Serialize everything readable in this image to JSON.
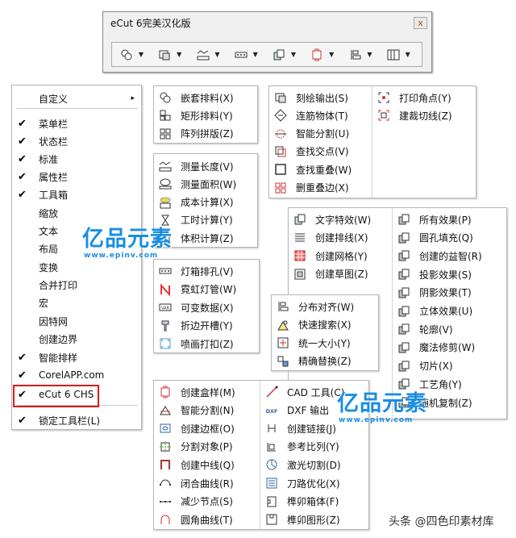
{
  "toolbar_window": {
    "title": "eCut 6完美汉化版",
    "close_label": "x",
    "groups": [
      {
        "icon": "nesting-icon"
      },
      {
        "icon": "output-icon"
      },
      {
        "icon": "measure-icon"
      },
      {
        "icon": "led-hole-icon"
      },
      {
        "icon": "effects-icon"
      },
      {
        "icon": "box-template-icon"
      },
      {
        "icon": "distribute-icon"
      },
      {
        "icon": "window-icon"
      }
    ]
  },
  "left_menu": {
    "items": [
      {
        "label": "自定义",
        "checked": false,
        "submenu": true
      },
      {
        "label": "菜单栏",
        "checked": true
      },
      {
        "label": "状态栏",
        "checked": true
      },
      {
        "label": "标准",
        "checked": true
      },
      {
        "label": "属性栏",
        "checked": true
      },
      {
        "label": "工具箱",
        "checked": true
      },
      {
        "label": "缩放",
        "checked": false
      },
      {
        "label": "文本",
        "checked": false
      },
      {
        "label": "布局",
        "checked": false
      },
      {
        "label": "变换",
        "checked": false
      },
      {
        "label": "合并打印",
        "checked": false
      },
      {
        "label": "宏",
        "checked": false
      },
      {
        "label": "因特网",
        "checked": false
      },
      {
        "label": "创建边界",
        "checked": false
      },
      {
        "label": "智能排样",
        "checked": true
      },
      {
        "label": "CorelAPP.com",
        "checked": true
      },
      {
        "label": "eCut 6 CHS",
        "checked": true
      },
      {
        "label": "锁定工具栏(L)",
        "checked": true
      }
    ],
    "check_mark": "✔",
    "submenu_arrow": "▸"
  },
  "panel_nesting": {
    "items": [
      {
        "label": "嵌套排料(X)",
        "icon": "nest-icon"
      },
      {
        "label": "矩形排料(Y)",
        "icon": "rect-nest-icon"
      },
      {
        "label": "阵列拼版(Z)",
        "icon": "array-icon"
      }
    ]
  },
  "panel_output": {
    "items": [
      {
        "label": "刻绘输出(S)",
        "icon": "cut-output-icon"
      },
      {
        "label": "连筋物体(T)",
        "icon": "bridge-icon"
      },
      {
        "label": "智能分割(U)",
        "icon": "smart-split-icon"
      },
      {
        "label": "查找交点(V)",
        "icon": "find-intersect-icon"
      },
      {
        "label": "查找重叠(W)",
        "icon": "find-overlap-icon"
      },
      {
        "label": "删重叠边(X)",
        "icon": "delete-overlap-icon"
      }
    ],
    "items_right": [
      {
        "label": "打印角点(Y)",
        "icon": "print-corner-icon"
      },
      {
        "label": "建裁切线(Z)",
        "icon": "crop-line-icon"
      }
    ]
  },
  "panel_measure": {
    "items": [
      {
        "label": "测量长度(V)",
        "icon": "measure-length-icon"
      },
      {
        "label": "测量面积(W)",
        "icon": "measure-area-icon"
      },
      {
        "label": "成本计算(X)",
        "icon": "cost-icon"
      },
      {
        "label": "工时计算(Y)",
        "icon": "hourglass-icon"
      },
      {
        "label": "体积计算(Z)",
        "icon": "volume-icon"
      }
    ]
  },
  "panel_effects": {
    "items": [
      {
        "label": "文字特效(W)",
        "icon": "text-effect-icon"
      },
      {
        "label": "创建排线(X)",
        "icon": "lines-icon"
      },
      {
        "label": "创建网格(Y)",
        "icon": "grid-icon"
      },
      {
        "label": "创建草图(Z)",
        "icon": "sketch-icon"
      }
    ],
    "items_right": [
      {
        "label": "所有效果(P)",
        "icon": "all-effects-icon"
      },
      {
        "label": "圆孔填充(Q)",
        "icon": "hole-fill-icon"
      },
      {
        "label": "创建的益智(R)",
        "icon": "puzzle-icon"
      },
      {
        "label": "投影效果(S)",
        "icon": "shadow-icon"
      },
      {
        "label": "阴影效果(T)",
        "icon": "shade-icon"
      },
      {
        "label": "立体效果(U)",
        "icon": "3d-icon"
      },
      {
        "label": "轮廓(V)",
        "icon": "contour-icon"
      },
      {
        "label": "魔法修剪(W)",
        "icon": "magic-trim-icon"
      },
      {
        "label": "切片(X)",
        "icon": "slice-icon"
      },
      {
        "label": "工艺角(Y)",
        "icon": "craft-corner-icon"
      },
      {
        "label": "随机复制(Z)",
        "icon": "random-copy-icon"
      }
    ]
  },
  "panel_led": {
    "items": [
      {
        "label": "灯箱排孔(V)",
        "icon": "led-hole-icon"
      },
      {
        "label": "霓虹灯管(W)",
        "icon": "neon-icon"
      },
      {
        "label": "可变数据(X)",
        "icon": "variable-data-icon"
      },
      {
        "label": "折边开槽(Y)",
        "icon": "fold-slot-icon"
      },
      {
        "label": "喷画打扣(Z)",
        "icon": "grommet-icon"
      }
    ]
  },
  "panel_distribute": {
    "items": [
      {
        "label": "分布对齐(W)",
        "icon": "distribute-icon"
      },
      {
        "label": "快速搜索(X)",
        "icon": "quick-search-icon"
      },
      {
        "label": "统一大小(Y)",
        "icon": "uniform-size-icon"
      },
      {
        "label": "精确替换(Z)",
        "icon": "replace-icon"
      }
    ]
  },
  "panel_box": {
    "items": [
      {
        "label": "创建盒样(M)",
        "icon": "box-icon"
      },
      {
        "label": "智能分割(N)",
        "icon": "smart-split-2-icon"
      },
      {
        "label": "创建边框(O)",
        "icon": "frame-icon"
      },
      {
        "label": "分割对象(P)",
        "icon": "split-object-icon"
      },
      {
        "label": "创建中线(Q)",
        "icon": "centerline-icon"
      },
      {
        "label": "闭合曲线(R)",
        "icon": "close-curve-icon"
      },
      {
        "label": "减少节点(S)",
        "icon": "reduce-nodes-icon"
      },
      {
        "label": "圆角曲线(T)",
        "icon": "round-curve-icon"
      }
    ],
    "items_right": [
      {
        "label": "CAD 工具(C)",
        "icon": "cad-icon"
      },
      {
        "label": "DXF 输出",
        "icon": "dxf-icon",
        "icon_text": "DXF"
      },
      {
        "label": "创建链接(J)",
        "icon": "link-icon"
      },
      {
        "label": "参考比列(Y)",
        "icon": "scale-ref-icon"
      },
      {
        "label": "激光切割(D)",
        "icon": "laser-icon"
      },
      {
        "label": "刀路优化(X)",
        "icon": "toolpath-icon"
      },
      {
        "label": "榫卯箱体(F)",
        "icon": "tenon-box-icon"
      },
      {
        "label": "榫卯图形(Z)",
        "icon": "tenon-shape-icon"
      }
    ]
  },
  "watermark": {
    "name": "亿品元素",
    "url": "www.epinv.com"
  },
  "footer": "头条 @四色印素材库"
}
